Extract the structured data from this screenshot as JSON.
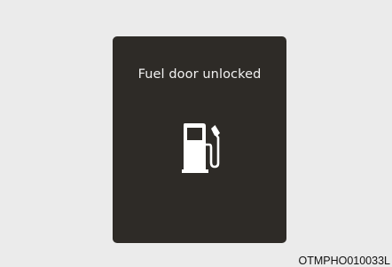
{
  "display": {
    "message": "Fuel door unlocked",
    "icon": "fuel-pump-icon",
    "background_color": "#2e2b27",
    "icon_color": "#ffffff"
  },
  "image_code": "OTMPHO010033L"
}
